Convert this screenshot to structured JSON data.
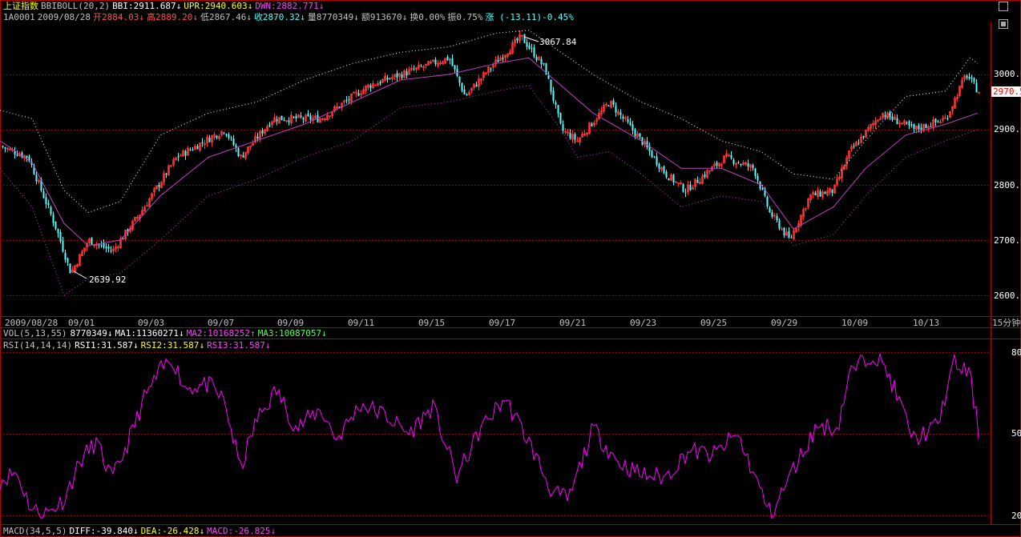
{
  "colors": {
    "background": "#000000",
    "grid": "#8b0000",
    "frame": "#b00000",
    "up_candle": "#ff3232",
    "down_candle": "#54ffff",
    "boll_band": "#ffffff",
    "boll_mid": "#c040c0",
    "rsi_line": "#ff00ff",
    "label_yellow": "#ffff00",
    "label_white": "#ffffff",
    "label_red": "#ff5050",
    "label_green": "#54ff54",
    "label_cyan": "#54ffff",
    "label_magenta": "#ff40ff"
  },
  "header": {
    "index_name": "上证指数",
    "indicator": "BBIBOLL(20,2)",
    "bbi": "BBI:2911.687",
    "upr": "UPR:2940.603",
    "dwn": "DWN:2882.771",
    "arrow_down": "↓",
    "arrow_up": "↑"
  },
  "quote": {
    "code": "1A0001",
    "date": "2009/08/28",
    "open": "开2884.03",
    "high": "高2889.20",
    "low": "低2867.46",
    "close": "收2870.32",
    "volume": "量8770349",
    "amount": "额913670",
    "turnover": "换0.00%",
    "amplitude": "振0.75%",
    "change": "涨 (-13.11)-0.45%"
  },
  "vol_row": {
    "name": "VOL(5,13,55)",
    "value": "8770349",
    "ma1": "MA1:11360271",
    "ma2": "MA2:10168252",
    "ma3": "MA3:10087057"
  },
  "rsi_row": {
    "name": "RSI(14,14,14)",
    "rsi1": "RSI1:31.587",
    "rsi2": "RSI2:31.587",
    "rsi3": "RSI3:31.587"
  },
  "macd_row": {
    "name": "MACD(34,5,5)",
    "diff": "DIFF:-39.840",
    "dea": "DEA:-26.428",
    "macd": "MACD:-26.825"
  },
  "annotations": {
    "high_label": "3067.84",
    "low_label": "2639.92",
    "last_price": "2970.5"
  },
  "period_label": "15分钟",
  "chart_data": [
    {
      "type": "candlestick",
      "title": "上证指数",
      "ylim": [
        2580,
        3080
      ],
      "y_ticks": [
        "3000.00",
        "2900.00",
        "2800.00",
        "2700.00",
        "2600.00"
      ],
      "x_ticks": [
        "2009/08/28",
        "09/01",
        "09/03",
        "09/07",
        "09/09",
        "09/11",
        "09/15",
        "09/17",
        "09/21",
        "09/23",
        "09/25",
        "09/29",
        "10/09",
        "10/13"
      ],
      "close_path": [
        [
          0,
          2870
        ],
        [
          35,
          2850
        ],
        [
          70,
          2720
        ],
        [
          88,
          2640
        ],
        [
          110,
          2700
        ],
        [
          140,
          2680
        ],
        [
          175,
          2750
        ],
        [
          220,
          2850
        ],
        [
          280,
          2900
        ],
        [
          300,
          2850
        ],
        [
          340,
          2920
        ],
        [
          400,
          2920
        ],
        [
          460,
          2980
        ],
        [
          520,
          3010
        ],
        [
          560,
          3030
        ],
        [
          580,
          2960
        ],
        [
          610,
          3010
        ],
        [
          650,
          3068
        ],
        [
          680,
          3010
        ],
        [
          700,
          2900
        ],
        [
          720,
          2880
        ],
        [
          760,
          2950
        ],
        [
          800,
          2880
        ],
        [
          830,
          2820
        ],
        [
          855,
          2790
        ],
        [
          880,
          2820
        ],
        [
          905,
          2850
        ],
        [
          940,
          2830
        ],
        [
          960,
          2750
        ],
        [
          985,
          2700
        ],
        [
          1010,
          2780
        ],
        [
          1040,
          2790
        ],
        [
          1060,
          2860
        ],
        [
          1100,
          2930
        ],
        [
          1140,
          2900
        ],
        [
          1180,
          2920
        ],
        [
          1205,
          3000
        ],
        [
          1220,
          2970
        ]
      ],
      "bbi": [
        [
          0,
          2880
        ],
        [
          40,
          2840
        ],
        [
          80,
          2730
        ],
        [
          110,
          2690
        ],
        [
          150,
          2700
        ],
        [
          200,
          2780
        ],
        [
          260,
          2850
        ],
        [
          320,
          2880
        ],
        [
          380,
          2910
        ],
        [
          440,
          2950
        ],
        [
          500,
          2990
        ],
        [
          560,
          3000
        ],
        [
          620,
          3020
        ],
        [
          660,
          3030
        ],
        [
          700,
          2980
        ],
        [
          740,
          2930
        ],
        [
          800,
          2880
        ],
        [
          850,
          2830
        ],
        [
          900,
          2830
        ],
        [
          950,
          2800
        ],
        [
          990,
          2720
        ],
        [
          1040,
          2760
        ],
        [
          1080,
          2830
        ],
        [
          1130,
          2890
        ],
        [
          1180,
          2910
        ],
        [
          1220,
          2930
        ]
      ],
      "upper_band": [
        [
          0,
          2935
        ],
        [
          40,
          2920
        ],
        [
          80,
          2790
        ],
        [
          110,
          2750
        ],
        [
          150,
          2770
        ],
        [
          200,
          2890
        ],
        [
          260,
          2930
        ],
        [
          320,
          2950
        ],
        [
          380,
          2990
        ],
        [
          440,
          3020
        ],
        [
          500,
          3040
        ],
        [
          560,
          3050
        ],
        [
          620,
          3075
        ],
        [
          660,
          3080
        ],
        [
          700,
          3040
        ],
        [
          740,
          3000
        ],
        [
          800,
          2950
        ],
        [
          850,
          2920
        ],
        [
          900,
          2880
        ],
        [
          950,
          2860
        ],
        [
          990,
          2820
        ],
        [
          1040,
          2810
        ],
        [
          1080,
          2880
        ],
        [
          1130,
          2960
        ],
        [
          1180,
          2970
        ],
        [
          1210,
          3030
        ],
        [
          1220,
          3020
        ]
      ],
      "lower_band": [
        [
          0,
          2830
        ],
        [
          40,
          2760
        ],
        [
          80,
          2600
        ],
        [
          110,
          2630
        ],
        [
          150,
          2640
        ],
        [
          200,
          2700
        ],
        [
          260,
          2780
        ],
        [
          320,
          2810
        ],
        [
          380,
          2850
        ],
        [
          440,
          2880
        ],
        [
          500,
          2940
        ],
        [
          560,
          2950
        ],
        [
          620,
          2970
        ],
        [
          660,
          2980
        ],
        [
          700,
          2900
        ],
        [
          720,
          2850
        ],
        [
          760,
          2860
        ],
        [
          800,
          2820
        ],
        [
          850,
          2760
        ],
        [
          900,
          2780
        ],
        [
          950,
          2770
        ],
        [
          990,
          2690
        ],
        [
          1040,
          2710
        ],
        [
          1080,
          2780
        ],
        [
          1130,
          2850
        ],
        [
          1180,
          2880
        ],
        [
          1220,
          2900
        ]
      ]
    },
    {
      "type": "line",
      "title": "RSI(14,14,14)",
      "ylim": [
        20,
        80
      ],
      "y_ticks": [
        "80",
        "50",
        "20"
      ],
      "series": [
        {
          "name": "RSI1",
          "values": [
            [
              0,
              33
            ],
            [
              20,
              36
            ],
            [
              40,
              22
            ],
            [
              60,
              21
            ],
            [
              80,
              26
            ],
            [
              100,
              40
            ],
            [
              120,
              47
            ],
            [
              140,
              33
            ],
            [
              160,
              47
            ],
            [
              180,
              63
            ],
            [
              200,
              73
            ],
            [
              215,
              78
            ],
            [
              230,
              67
            ],
            [
              260,
              68
            ],
            [
              280,
              62
            ],
            [
              300,
              37
            ],
            [
              320,
              55
            ],
            [
              345,
              66
            ],
            [
              370,
              52
            ],
            [
              400,
              59
            ],
            [
              420,
              48
            ],
            [
              450,
              61
            ],
            [
              480,
              57
            ],
            [
              510,
              50
            ],
            [
              540,
              60
            ],
            [
              570,
              34
            ],
            [
              600,
              52
            ],
            [
              630,
              63
            ],
            [
              660,
              47
            ],
            [
              690,
              28
            ],
            [
              710,
              26
            ],
            [
              740,
              52
            ],
            [
              770,
              40
            ],
            [
              800,
              35
            ],
            [
              830,
              34
            ],
            [
              860,
              44
            ],
            [
              890,
              42
            ],
            [
              920,
              50
            ],
            [
              945,
              32
            ],
            [
              962,
              20
            ],
            [
              990,
              37
            ],
            [
              1020,
              53
            ],
            [
              1045,
              52
            ],
            [
              1060,
              72
            ],
            [
              1090,
              80
            ],
            [
              1110,
              71
            ],
            [
              1140,
              48
            ],
            [
              1170,
              53
            ],
            [
              1190,
              76
            ],
            [
              1210,
              72
            ],
            [
              1222,
              49
            ]
          ]
        }
      ]
    }
  ]
}
